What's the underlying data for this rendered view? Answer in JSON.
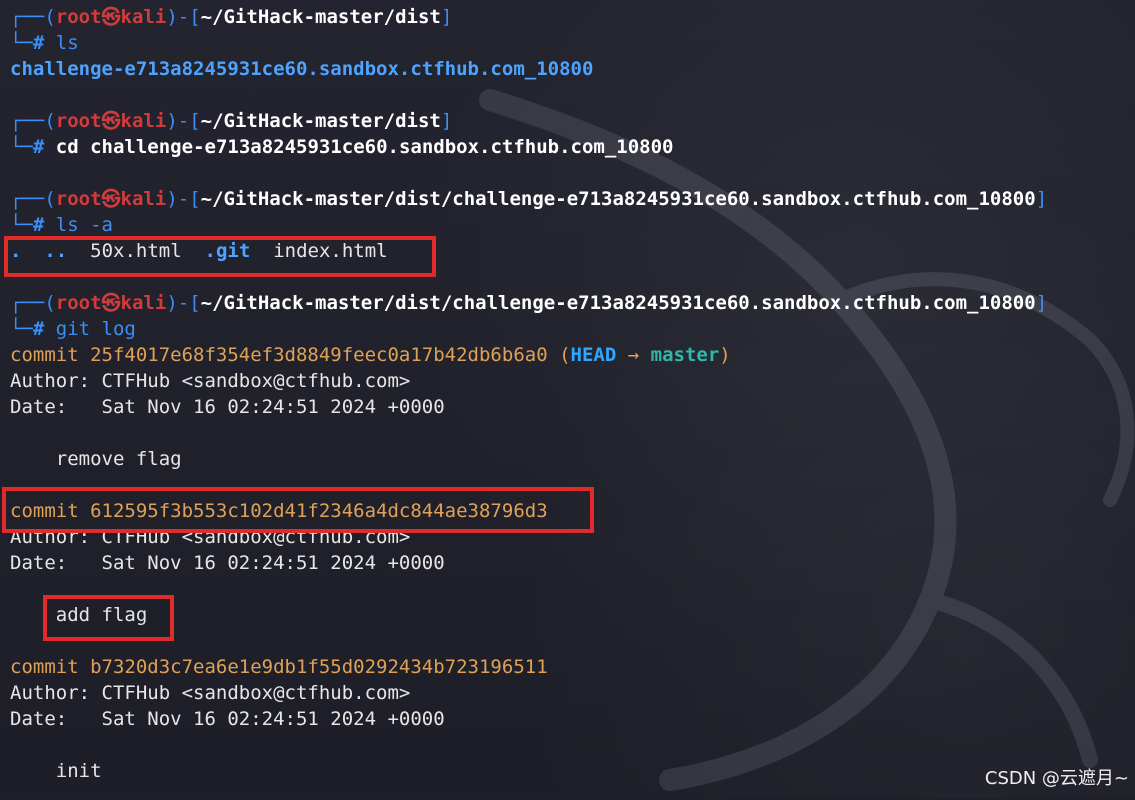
{
  "prompt": {
    "user": "root",
    "skull": "㉿",
    "host": "kali",
    "prefix_open": "┌──(",
    "prefix_close": ")-[",
    "suffix": "]",
    "second": "└─",
    "hash": "#"
  },
  "blocks": [
    {
      "cwd": "~/GitHack-master/dist",
      "cmd": "ls",
      "output": [
        "challenge-e713a8245931ce60.sandbox.ctfhub.com_10800"
      ]
    },
    {
      "cwd": "~/GitHack-master/dist",
      "cmd": "cd challenge-e713a8245931ce60.sandbox.ctfhub.com_10800",
      "output": []
    },
    {
      "cwd": "~/GitHack-master/dist/challenge-e713a8245931ce60.sandbox.ctfhub.com_10800",
      "cmd": "ls -a",
      "ls_items": {
        "dot": ".",
        "dotdot": "..",
        "file1": "50x.html",
        "git": ".git",
        "file2": "index.html"
      }
    },
    {
      "cwd": "~/GitHack-master/dist/challenge-e713a8245931ce60.sandbox.ctfhub.com_10800",
      "cmd": "git log"
    }
  ],
  "commits": [
    {
      "hash_line": "commit 25f4017e68f354ef3d8849feec0a17b42db6b6a0",
      "ref_open": " (",
      "head": "HEAD",
      "arrow": " → ",
      "branch": "master",
      "ref_close": ")",
      "author": "Author: CTFHub <sandbox@ctfhub.com>",
      "date": "Date:   Sat Nov 16 02:24:51 2024 +0000",
      "message": "    remove flag"
    },
    {
      "hash_line": "commit 612595f3b553c102d41f2346a4dc844ae38796d3",
      "author": "Author: CTFHub <sandbox@ctfhub.com>",
      "date": "Date:   Sat Nov 16 02:24:51 2024 +0000",
      "message": "    add flag"
    },
    {
      "hash_line": "commit b7320d3c7ea6e1e9db1f55d0292434b723196511",
      "author": "Author: CTFHub <sandbox@ctfhub.com>",
      "date": "Date:   Sat Nov 16 02:24:51 2024 +0000",
      "message": "    init"
    }
  ],
  "watermark": "CSDN @云遮月~",
  "colors": {
    "background": "#1e1f29",
    "prompt_blue": "#3d8ef7",
    "root_red": "#d23b3b",
    "commit_orange": "#e0a156",
    "branch_cyan": "#2fb7a8",
    "head_blue": "#2da7ff",
    "highlight_red": "#e12a2a"
  }
}
